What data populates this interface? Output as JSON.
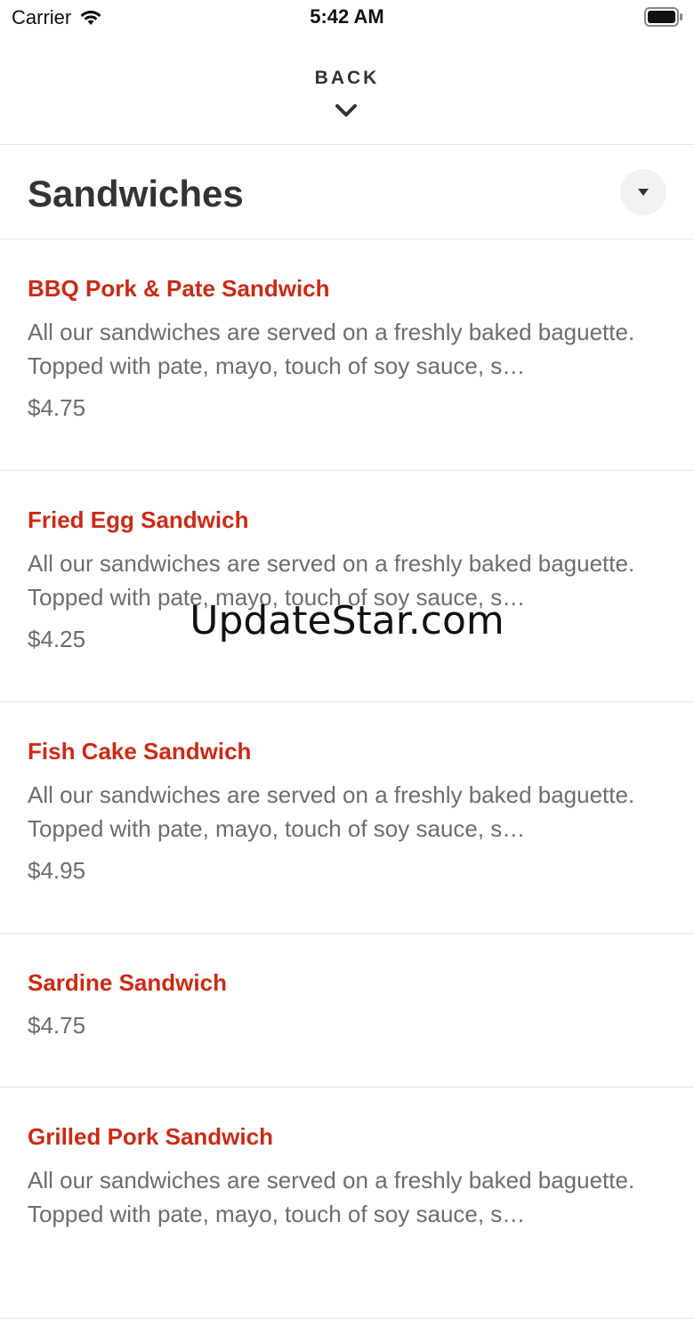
{
  "status_bar": {
    "carrier": "Carrier",
    "time": "5:42 AM",
    "icons": [
      "wifi-icon",
      "battery-icon"
    ]
  },
  "nav": {
    "back_label": "BACK",
    "icon": "chevron-down-icon"
  },
  "section": {
    "title": "Sandwiches",
    "dropdown_icon": "triangle-down-icon"
  },
  "items": [
    {
      "name": "BBQ Pork & Pate Sandwich",
      "description": "All our sandwiches are served on a freshly baked baguette. Topped with pate, mayo, touch of soy sauce, s…",
      "price": "$4.75"
    },
    {
      "name": "Fried Egg Sandwich",
      "description": "All our sandwiches are served on a freshly baked baguette. Topped with pate, mayo, touch of soy sauce, s…",
      "price": "$4.25"
    },
    {
      "name": "Fish Cake Sandwich",
      "description": "All our sandwiches are served on a freshly baked baguette. Topped with pate, mayo, touch of soy sauce, s…",
      "price": "$4.95"
    },
    {
      "name": "Sardine Sandwich",
      "price": "$4.75"
    },
    {
      "name": "Grilled Pork Sandwich",
      "description": "All our sandwiches are served on a freshly baked baguette. Topped with pate, mayo, touch of soy sauce, s…"
    }
  ],
  "watermark": "UpdateStar.com",
  "colors": {
    "item_name": "#cc2a14",
    "secondary_text": "#6d6d6d",
    "divider": "#e6e6e6"
  }
}
